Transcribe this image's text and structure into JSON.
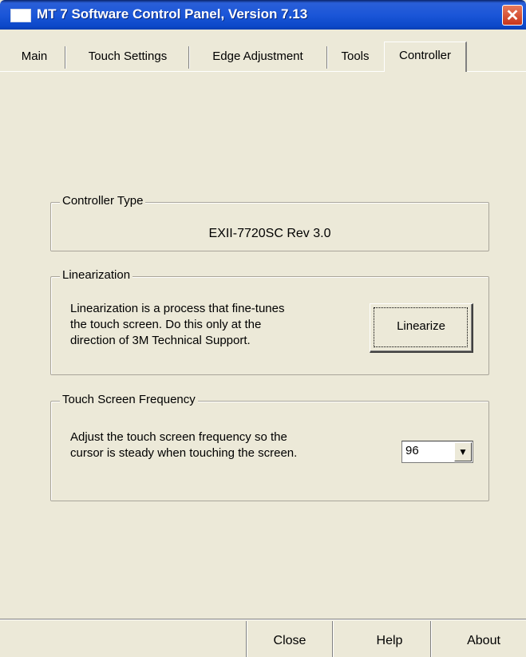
{
  "window": {
    "title": "MT 7 Software Control Panel, Version 7.13",
    "close_icon": "close-icon"
  },
  "tabs": [
    {
      "label": "Main"
    },
    {
      "label": "Touch Settings"
    },
    {
      "label": "Edge Adjustment"
    },
    {
      "label": "Tools"
    },
    {
      "label": "Controller",
      "active": true
    }
  ],
  "controller_type": {
    "group_label": "Controller Type",
    "value": "EXII-7720SC Rev 3.0"
  },
  "linearization": {
    "group_label": "Linearization",
    "description_lines": [
      "Linearization is a process that fine-tunes",
      "the touch screen. Do this only at the",
      "direction of 3M Technical Support."
    ],
    "button_label": "Linearize"
  },
  "frequency": {
    "group_label": "Touch Screen Frequency",
    "description_lines": [
      "Adjust the touch screen frequency so the",
      "cursor is steady when touching the screen."
    ],
    "selected_value": "96"
  },
  "footer": {
    "close_label": "Close",
    "help_label": "Help",
    "about_label": "About"
  },
  "colors": {
    "titlebar": "#1b56d8",
    "background": "#ece9d8",
    "close_button": "#c7351a"
  }
}
